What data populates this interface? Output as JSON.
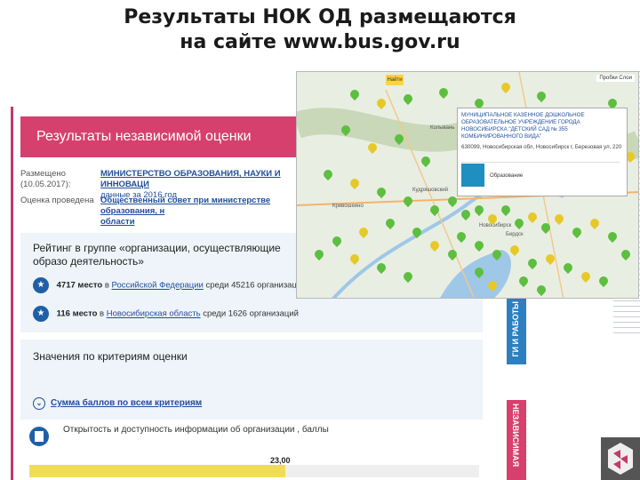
{
  "slide": {
    "title_line1": "Результаты НОК ОД размещаются",
    "title_line2": "на сайте www.bus.gov.ru"
  },
  "site": {
    "header": "Результаты независимой оценки",
    "meta": [
      {
        "label": "Размещено (10.05.2017):",
        "value": "МИНИСТЕРСТВО ОБРАЗОВАНИЯ, НАУКИ И ИННОВАЦИ",
        "sub": "данные за 2016 год"
      },
      {
        "label": "Оценка проведена",
        "value": "Общественный совет при министерстве образования, н",
        "sub": "области"
      }
    ],
    "rating": {
      "title": "Рейтинг в группе «организации, осуществляющие образо деятельность»",
      "rows": [
        {
          "place": "4717 место",
          "prefix": "в",
          "region": "Российской Федерации",
          "suffix": "среди 45216 организаций"
        },
        {
          "place": "116 место",
          "prefix": "в",
          "region": "Новосибирская область",
          "suffix": "среди 1626 организаций"
        }
      ]
    },
    "criteria": {
      "title": "Значения по критериям оценки",
      "sum_link": "Сумма баллов по всем критериям",
      "open_info": "Открытость и доступность информации об организации , баллы",
      "value": "23,00",
      "fill": 0.57
    },
    "tabs": {
      "blue": "ГИ И РАБОТЫ",
      "pink": "НЕЗАВИСИМАЯ"
    }
  },
  "map": {
    "search": "Найти",
    "tools": "Пробки  Слои",
    "popup": {
      "title": "МУНИЦИПАЛЬНОЕ КАЗЕННОЕ ДОШКОЛЬНОЕ ОБРАЗОВАТЕЛЬНОЕ УЧРЕЖДЕНИЕ ГОРОДА НОВОСИБИРСКА \"ДЕТСКИЙ САД № 355 КОМБИНИРОВАННОГО ВИДА\"",
      "address": "630099, Новосибирская обл, Новосибирск г, Березовая ул, 220",
      "category": "Образование"
    },
    "cities": [
      "Колывань",
      "Кривошеино",
      "Кудряшовский",
      "Новосибирск",
      "Бердск"
    ]
  }
}
